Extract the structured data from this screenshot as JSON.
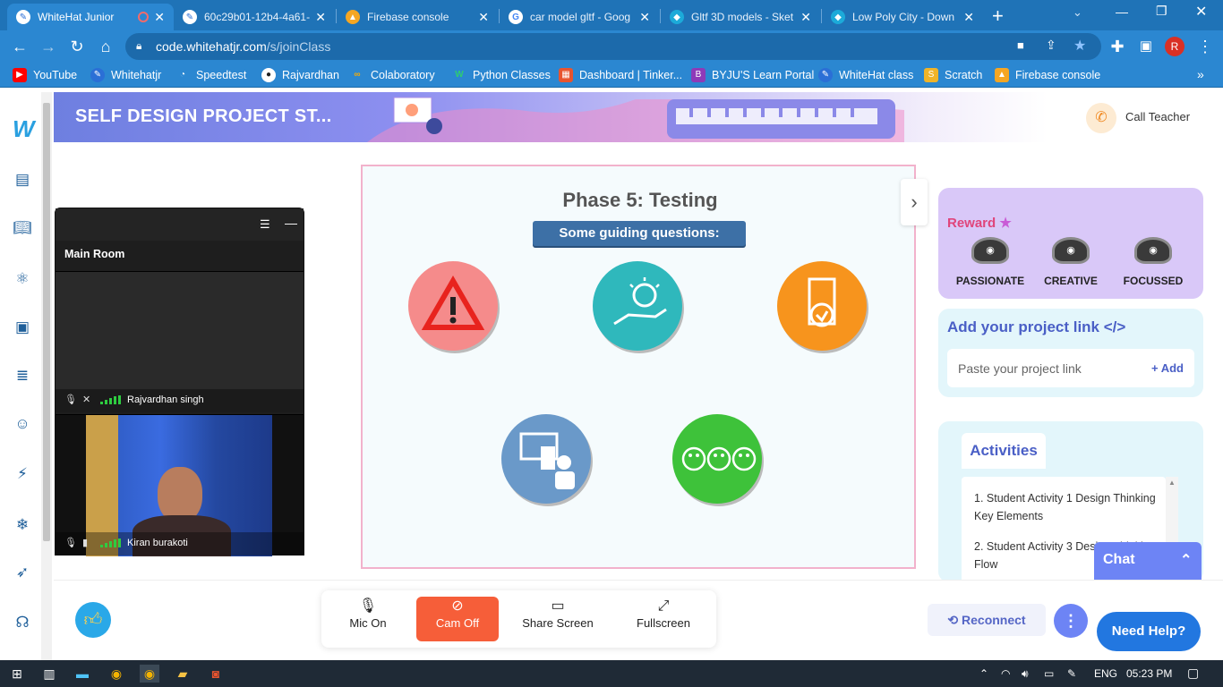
{
  "browser": {
    "tabs": [
      {
        "title": "WhiteHat Junior",
        "active": true
      },
      {
        "title": "60c29b01-12b4-4a61-",
        "active": false
      },
      {
        "title": "Firebase console",
        "active": false
      },
      {
        "title": "car model gltf - Goog",
        "active": false
      },
      {
        "title": "Gltf 3D models - Sket",
        "active": false
      },
      {
        "title": "Low Poly City - Down",
        "active": false
      }
    ],
    "url_host": "code.whitehatjr.com",
    "url_path": "/s/joinClass",
    "profile_initial": "R",
    "bookmarks": [
      {
        "label": "YouTube",
        "color": "#ff0000"
      },
      {
        "label": "Whitehatjr",
        "color": "#2b6fd6"
      },
      {
        "label": "Speedtest",
        "color": "#222222"
      },
      {
        "label": "Rajvardhan",
        "color": "#222222"
      },
      {
        "label": "Colaboratory",
        "color": "#f9ab00"
      },
      {
        "label": "Python Classes",
        "color": "#1a9c4a"
      },
      {
        "label": "Dashboard | Tinker...",
        "color": "#e8542f"
      },
      {
        "label": "BYJU'S Learn Portal",
        "color": "#8e3ab8"
      },
      {
        "label": "WhiteHat class",
        "color": "#2b6fd6"
      },
      {
        "label": "Scratch",
        "color": "#f0b429"
      },
      {
        "label": "Firebase console",
        "color": "#f5a623"
      }
    ]
  },
  "header": {
    "project_title": "SELF DESIGN PROJECT ST...",
    "call_teacher": "Call Teacher"
  },
  "video": {
    "room": "Main Room",
    "participants": [
      {
        "name": "Rajvardhan singh"
      },
      {
        "name": "Kiran burakoti"
      }
    ]
  },
  "slide": {
    "title": "Phase 5: Testing",
    "subtitle": "Some guiding questions:"
  },
  "reward": {
    "label": "Reward",
    "badges": [
      "PASSIONATE",
      "CREATIVE",
      "FOCUSSED"
    ]
  },
  "project_link": {
    "title": "Add your project link </>",
    "placeholder": "Paste your project link",
    "add_label": "+ Add"
  },
  "activities": {
    "tab_label": "Activities",
    "items": [
      "1. Student Activity 1 Design Thinking Key Elements",
      "2. Student Activity 3 Design Thinking Flow"
    ]
  },
  "chat": {
    "label": "Chat"
  },
  "controls": {
    "mic": "Mic On",
    "cam": "Cam Off",
    "share": "Share Screen",
    "fullscreen": "Fullscreen"
  },
  "actions": {
    "reconnect": "Reconnect",
    "help": "Need Help?"
  },
  "taskbar": {
    "lang": "ENG",
    "time": "05:23 PM"
  }
}
